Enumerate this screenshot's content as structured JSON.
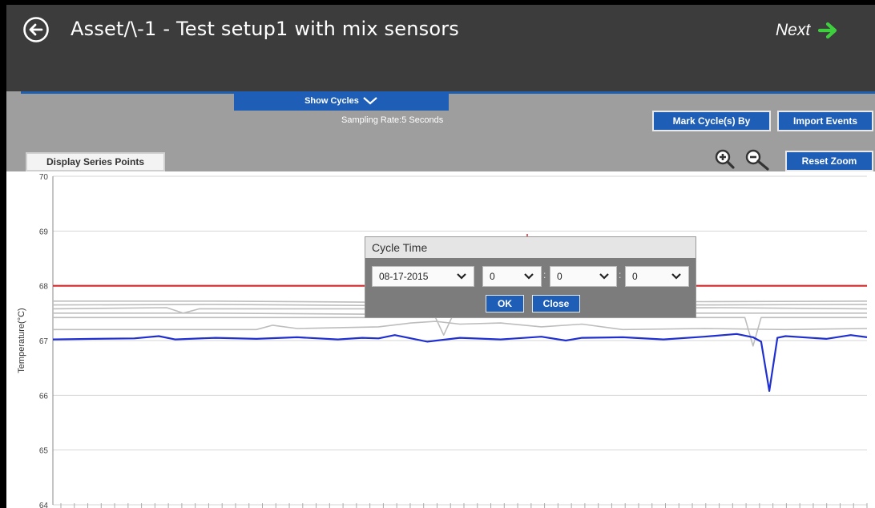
{
  "header": {
    "title": "Asset/\\-1 - Test setup1 with mix sensors",
    "next_label": "Next",
    "back_icon": "back-arrow-circle-icon",
    "next_icon": "arrow-right-icon"
  },
  "toolbar": {
    "show_cycles_label": "Show Cycles",
    "sampling_rate": "Sampling Rate:5 Seconds",
    "mark_cycles_label": "Mark Cycle(s) By",
    "import_events_label": "Import Events",
    "display_series_points_label": "Display Series Points",
    "reset_zoom_label": "Reset Zoom"
  },
  "dialog": {
    "title": "Cycle Time",
    "date_value": "08-17-2015",
    "hour_value": "0",
    "minute_value": "0",
    "second_value": "0",
    "separator": ":",
    "ok_label": "OK",
    "close_label": "Close"
  },
  "colors": {
    "header_bg": "#3c3c3c",
    "accent_blue": "#1e5eb6",
    "toolbar_bg": "#9e9e9e",
    "series_red": "#d22a2a",
    "series_blue": "#1f2fd0",
    "series_gray": "#bdbdbd",
    "next_arrow": "#3ecf3e"
  },
  "chart_data": {
    "type": "line",
    "ylabel": "Temperature(°C)",
    "ylim": [
      64,
      70
    ],
    "y_ticks": [
      "70",
      "69",
      "68",
      "67",
      "66",
      "65",
      "64"
    ],
    "grid": true,
    "series": [
      {
        "color": "#d22a2a",
        "points": [
          [
            0,
            68.0
          ],
          [
            0.42,
            68.0
          ],
          [
            0.44,
            67.92
          ],
          [
            0.46,
            67.92
          ],
          [
            0.48,
            68.0
          ],
          [
            1,
            68.0
          ]
        ]
      },
      {
        "color": "#bdbdbd",
        "points": [
          [
            0,
            67.72
          ],
          [
            0.2,
            67.72
          ],
          [
            0.4,
            67.7
          ],
          [
            0.6,
            67.72
          ],
          [
            0.8,
            67.71
          ],
          [
            1,
            67.72
          ]
        ]
      },
      {
        "color": "#bdbdbd",
        "points": [
          [
            0,
            67.65
          ],
          [
            0.2,
            67.66
          ],
          [
            0.4,
            67.64
          ],
          [
            0.6,
            67.66
          ],
          [
            0.8,
            67.65
          ],
          [
            1,
            67.66
          ]
        ]
      },
      {
        "color": "#bdbdbd",
        "points": [
          [
            0,
            67.58
          ],
          [
            0.14,
            67.6
          ],
          [
            0.16,
            67.5
          ],
          [
            0.18,
            67.58
          ],
          [
            0.5,
            67.58
          ],
          [
            0.82,
            67.6
          ],
          [
            1,
            67.58
          ]
        ]
      },
      {
        "color": "#bdbdbd",
        "points": [
          [
            0,
            67.5
          ],
          [
            0.2,
            67.5
          ],
          [
            0.4,
            67.48
          ],
          [
            0.6,
            67.5
          ],
          [
            0.8,
            67.5
          ],
          [
            1,
            67.5
          ]
        ]
      },
      {
        "color": "#bdbdbd",
        "points": [
          [
            0,
            67.42
          ],
          [
            0.3,
            67.42
          ],
          [
            0.47,
            67.42
          ],
          [
            0.48,
            67.1
          ],
          [
            0.49,
            67.42
          ],
          [
            0.7,
            67.42
          ],
          [
            0.85,
            67.42
          ],
          [
            0.86,
            66.9
          ],
          [
            0.87,
            67.42
          ],
          [
            1,
            67.42
          ]
        ]
      },
      {
        "color": "#bdbdbd",
        "points": [
          [
            0,
            67.2
          ],
          [
            0.25,
            67.2
          ],
          [
            0.27,
            67.28
          ],
          [
            0.3,
            67.22
          ],
          [
            0.4,
            67.25
          ],
          [
            0.44,
            67.32
          ],
          [
            0.47,
            67.35
          ],
          [
            0.5,
            67.3
          ],
          [
            0.55,
            67.32
          ],
          [
            0.6,
            67.25
          ],
          [
            0.65,
            67.3
          ],
          [
            0.7,
            67.2
          ],
          [
            0.8,
            67.22
          ],
          [
            0.9,
            67.2
          ],
          [
            1,
            67.22
          ]
        ]
      },
      {
        "color": "#1f2fd0",
        "points": [
          [
            0,
            67.02
          ],
          [
            0.05,
            67.03
          ],
          [
            0.1,
            67.04
          ],
          [
            0.13,
            67.08
          ],
          [
            0.15,
            67.02
          ],
          [
            0.2,
            67.05
          ],
          [
            0.25,
            67.03
          ],
          [
            0.3,
            67.06
          ],
          [
            0.35,
            67.02
          ],
          [
            0.38,
            67.05
          ],
          [
            0.4,
            67.04
          ],
          [
            0.42,
            67.1
          ],
          [
            0.44,
            67.04
          ],
          [
            0.46,
            66.98
          ],
          [
            0.5,
            67.05
          ],
          [
            0.55,
            67.02
          ],
          [
            0.6,
            67.07
          ],
          [
            0.63,
            67.0
          ],
          [
            0.65,
            67.05
          ],
          [
            0.7,
            67.06
          ],
          [
            0.75,
            67.02
          ],
          [
            0.8,
            67.07
          ],
          [
            0.84,
            67.12
          ],
          [
            0.86,
            67.06
          ],
          [
            0.87,
            66.98
          ],
          [
            0.88,
            66.08
          ],
          [
            0.89,
            67.05
          ],
          [
            0.9,
            67.08
          ],
          [
            0.95,
            67.03
          ],
          [
            0.98,
            67.1
          ],
          [
            1,
            67.06
          ]
        ]
      }
    ]
  }
}
